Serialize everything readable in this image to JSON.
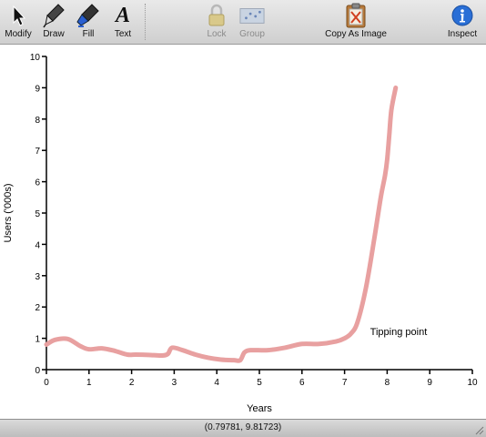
{
  "toolbar": {
    "modify": {
      "label": "Modify",
      "icon": "arrow-pointer-icon"
    },
    "draw": {
      "label": "Draw",
      "icon": "pen-icon"
    },
    "fill": {
      "label": "Fill",
      "icon": "fill-marker-icon"
    },
    "text": {
      "label": "Text",
      "icon": "text-A-icon"
    },
    "lock": {
      "label": "Lock",
      "icon": "padlock-icon"
    },
    "group": {
      "label": "Group",
      "icon": "group-icon"
    },
    "copy": {
      "label": "Copy As Image",
      "icon": "clipboard-icon"
    },
    "inspect": {
      "label": "Inspect",
      "icon": "info-icon"
    }
  },
  "status": {
    "coords": "(0.79781, 9.81723)"
  },
  "colors": {
    "curve": "#e8a0a0",
    "inspect_blue": "#2a6fd6"
  },
  "chart_data": {
    "type": "line",
    "title": "",
    "xlabel": "Years",
    "ylabel": "Users ('000s)",
    "xlim": [
      0,
      10
    ],
    "ylim": [
      0,
      10
    ],
    "xticks": [
      "0",
      "1",
      "2",
      "3",
      "4",
      "5",
      "6",
      "7",
      "8",
      "9",
      "10"
    ],
    "yticks": [
      "0",
      "1",
      "2",
      "3",
      "4",
      "5",
      "6",
      "7",
      "8",
      "9",
      "10"
    ],
    "grid": false,
    "annotation": {
      "text": "Tipping point",
      "x": 7.6,
      "y": 1.1
    },
    "series": [
      {
        "x": [
          0.0,
          0.2,
          0.5,
          0.8,
          1.0,
          1.3,
          1.6,
          1.9,
          2.1,
          2.4,
          2.7,
          2.85,
          2.95,
          3.2,
          3.5,
          3.8,
          4.1,
          4.4,
          4.55,
          4.65,
          4.8,
          5.2,
          5.6,
          6.0,
          6.4,
          6.8,
          7.0,
          7.15,
          7.3,
          7.5,
          7.7,
          7.85,
          7.95,
          8.0,
          8.05,
          8.1,
          8.2
        ],
        "y": [
          0.8,
          0.95,
          0.98,
          0.75,
          0.65,
          0.68,
          0.6,
          0.48,
          0.48,
          0.47,
          0.45,
          0.5,
          0.7,
          0.62,
          0.48,
          0.38,
          0.32,
          0.3,
          0.3,
          0.55,
          0.62,
          0.62,
          0.7,
          0.82,
          0.82,
          0.9,
          1.0,
          1.15,
          1.5,
          2.6,
          4.2,
          5.5,
          6.2,
          6.7,
          7.5,
          8.3,
          9.0
        ]
      }
    ]
  }
}
